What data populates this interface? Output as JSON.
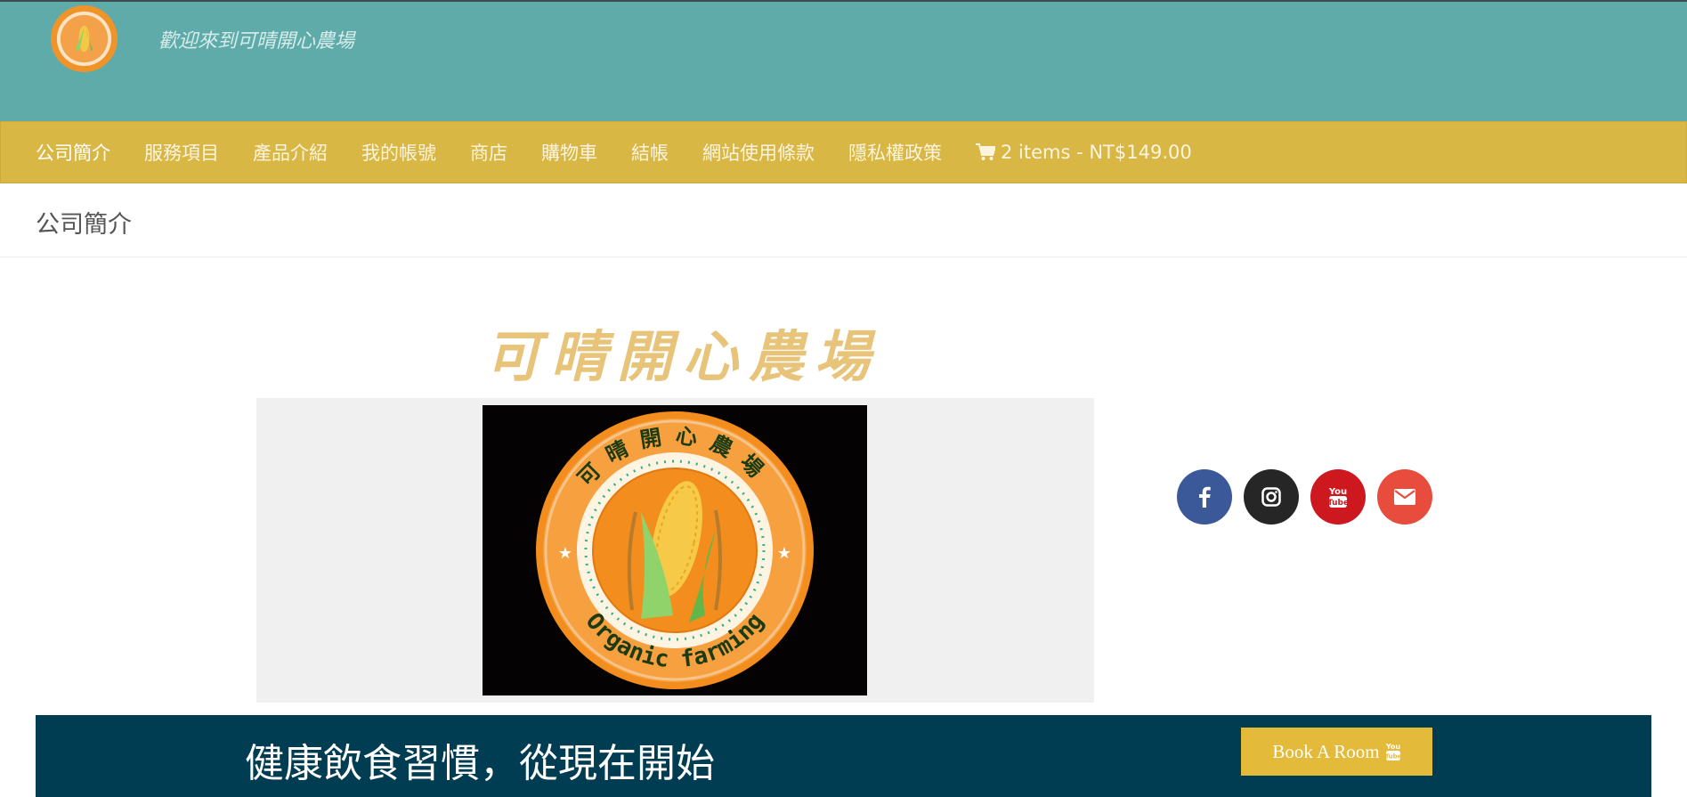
{
  "header": {
    "tagline": "歡迎來到可晴開心農場",
    "logo_icon": "corn-farm-logo"
  },
  "nav": {
    "items": [
      {
        "label": "公司簡介",
        "active": true
      },
      {
        "label": "服務項目"
      },
      {
        "label": "產品介紹"
      },
      {
        "label": "我的帳號"
      },
      {
        "label": "商店"
      },
      {
        "label": "購物車"
      },
      {
        "label": "結帳"
      },
      {
        "label": "網站使用條款"
      },
      {
        "label": "隱私權政策"
      }
    ],
    "cart": {
      "icon": "shopping-cart-icon",
      "label": "2 items - NT$149.00"
    }
  },
  "page": {
    "title": "公司簡介"
  },
  "main": {
    "heading": "可晴開心農場",
    "logo_image": {
      "top_text": "可晴開心農場",
      "bottom_text": "Organic farming"
    }
  },
  "social": [
    {
      "name": "facebook",
      "icon": "facebook-icon",
      "color": "#3b5998"
    },
    {
      "name": "instagram",
      "icon": "instagram-icon",
      "color": "#262626"
    },
    {
      "name": "youtube",
      "icon": "youtube-icon",
      "color": "#cc181e"
    },
    {
      "name": "email",
      "icon": "envelope-icon",
      "color": "#e84c3d"
    }
  ],
  "cta": {
    "text": "健康飲食習慣，從現在開始",
    "button_label": "Book A Room",
    "button_icon": "youtube-icon"
  },
  "colors": {
    "header_bg": "#5eabaa",
    "nav_bg": "#d9b745",
    "heading": "#e8c47a",
    "banner_bg": "#003d52",
    "button_bg": "#e3ba3a"
  }
}
